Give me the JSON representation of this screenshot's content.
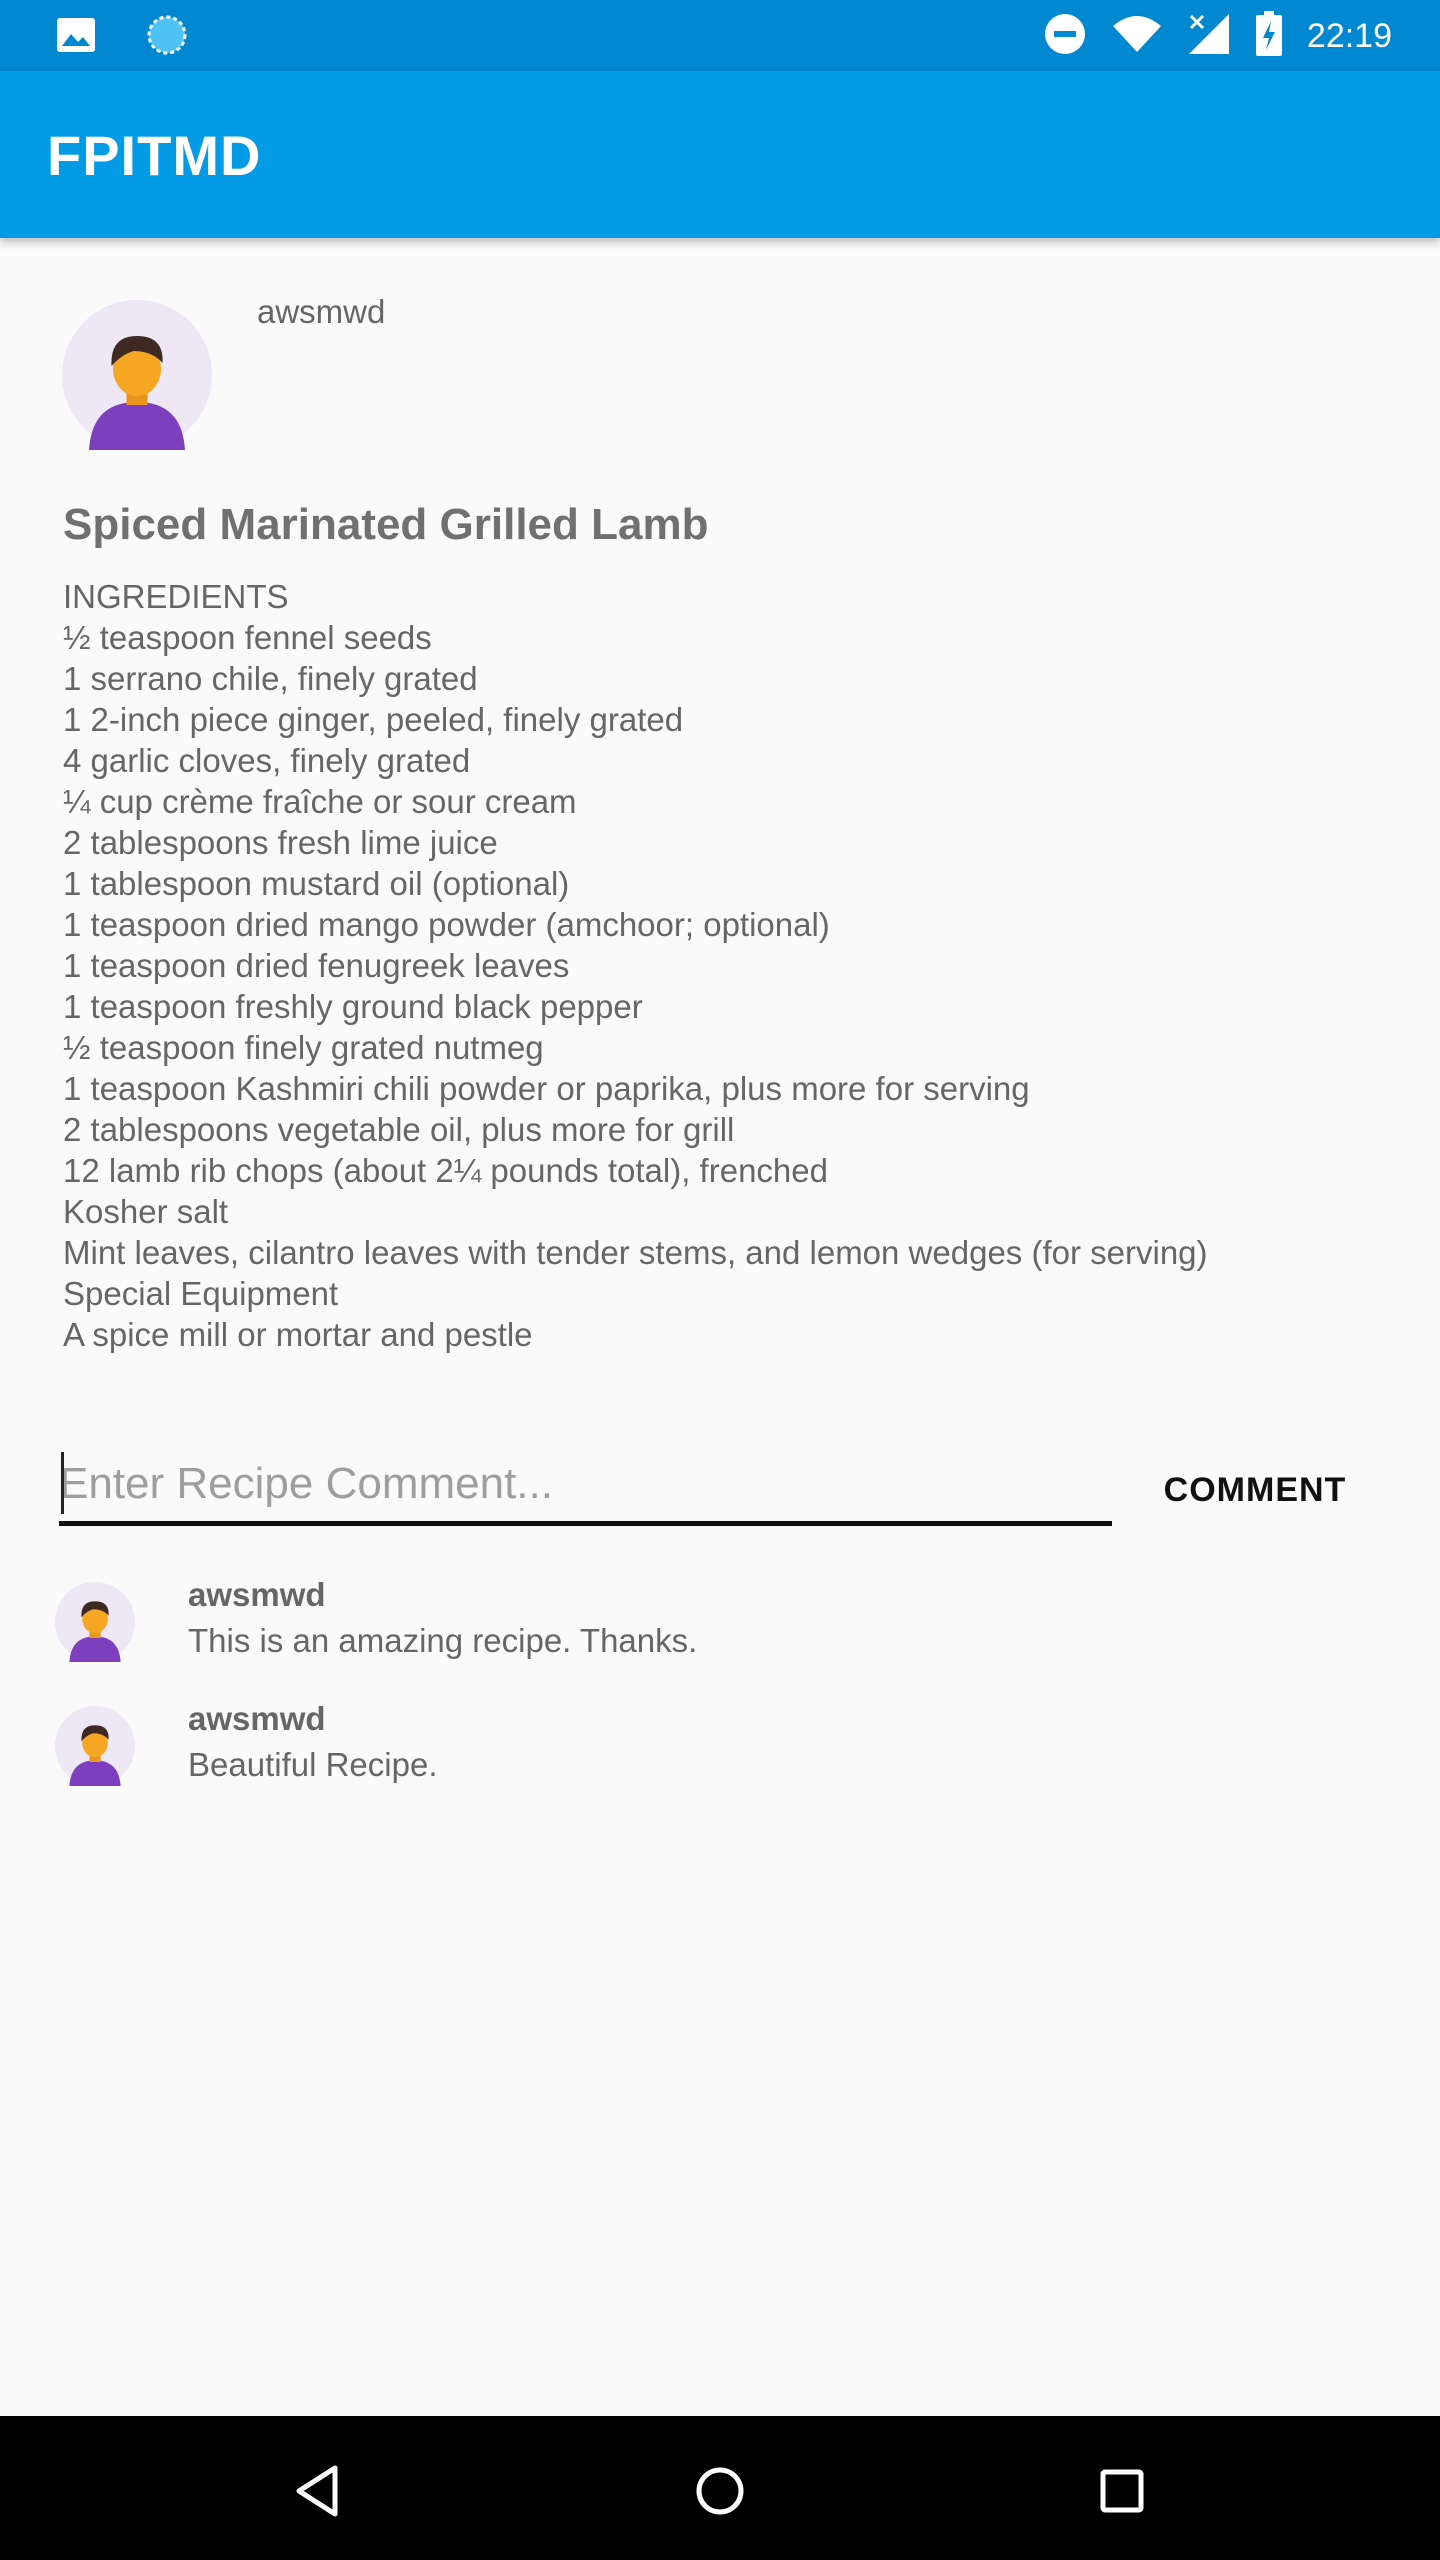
{
  "status_bar": {
    "time": "22:19",
    "icons": [
      "image-icon",
      "sync-icon",
      "do-not-disturb-icon",
      "wifi-icon",
      "signal-icon",
      "battery-icon"
    ]
  },
  "app_bar": {
    "title": "FPITMD"
  },
  "recipe": {
    "author": "awsmwd",
    "title": "Spiced Marinated Grilled Lamb",
    "lines": [
      "INGREDIENTS",
      "½ teaspoon fennel seeds",
      "1 serrano chile, finely grated",
      "1 2-inch piece ginger, peeled, finely grated",
      "4 garlic cloves, finely grated",
      "¼ cup crème fraîche or sour cream",
      "2 tablespoons fresh lime juice",
      "1 tablespoon mustard oil (optional)",
      "1 teaspoon dried mango powder (amchoor; optional)",
      "1 teaspoon dried fenugreek leaves",
      "1 teaspoon freshly ground black pepper",
      "½ teaspoon finely grated nutmeg",
      "1 teaspoon Kashmiri chili powder or paprika, plus more for serving",
      "2 tablespoons vegetable oil, plus more for grill",
      "12 lamb rib chops (about 2¼ pounds total), frenched",
      "Kosher salt",
      "Mint leaves, cilantro leaves with tender stems, and lemon wedges (for serving)",
      "Special Equipment",
      "A spice mill or mortar and pestle"
    ]
  },
  "comment_form": {
    "placeholder": "Enter Recipe Comment...",
    "value": "",
    "button_label": "COMMENT"
  },
  "comments": [
    {
      "user": "awsmwd",
      "text": "This is an amazing recipe. Thanks."
    },
    {
      "user": "awsmwd",
      "text": "Beautiful Recipe."
    }
  ],
  "colors": {
    "status_bar": "#0288d1",
    "app_bar": "#039be5",
    "avatar_bg": "#ede7f6",
    "avatar_shirt": "#7e3fbf",
    "avatar_skin": "#f5a623"
  }
}
